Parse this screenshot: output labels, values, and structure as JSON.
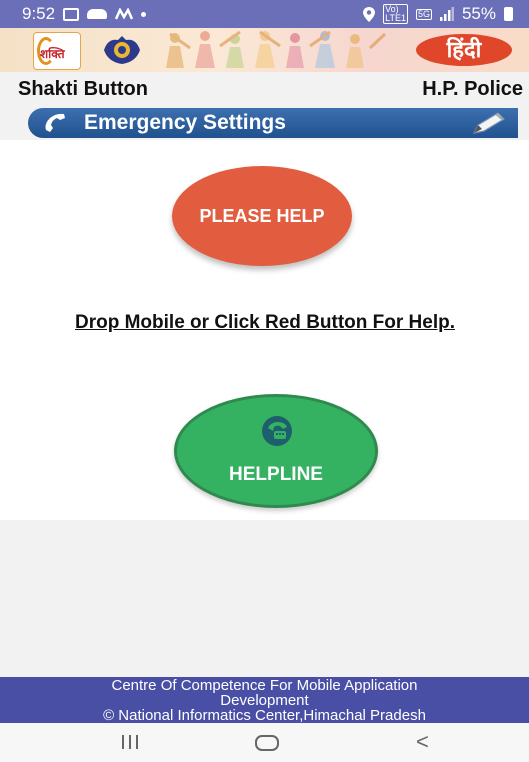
{
  "status_bar": {
    "time": "9:52",
    "signal_tag": "Vo)\nLTE1",
    "network_tag": "5G",
    "battery": "55%"
  },
  "header": {
    "logo_text": "शक्ति",
    "language_button": "हिंदी"
  },
  "title_row": {
    "app_name": "Shakti Button",
    "organization": "H.P. Police"
  },
  "settings_bar": {
    "label": "Emergency Settings",
    "left_icon": "phone-icon",
    "right_icon": "pencil-icon"
  },
  "main": {
    "help_button": "PLEASE HELP",
    "instruction": "Drop Mobile or Click Red Button For Help.",
    "helpline_button": "HELPLINE",
    "helpline_icon": "phone-call-icon"
  },
  "footer": {
    "line1": "Centre Of Competence For Mobile Application",
    "line2": "Development",
    "line3": "© National Informatics Center,Himachal Pradesh"
  },
  "colors": {
    "status_bar": "#6a6fb8",
    "help_button": "#e25c3f",
    "helpline_button": "#35b162",
    "settings_bar": "#2f5f9f",
    "footer": "#4a4fa6",
    "language_button": "#e0462a"
  }
}
